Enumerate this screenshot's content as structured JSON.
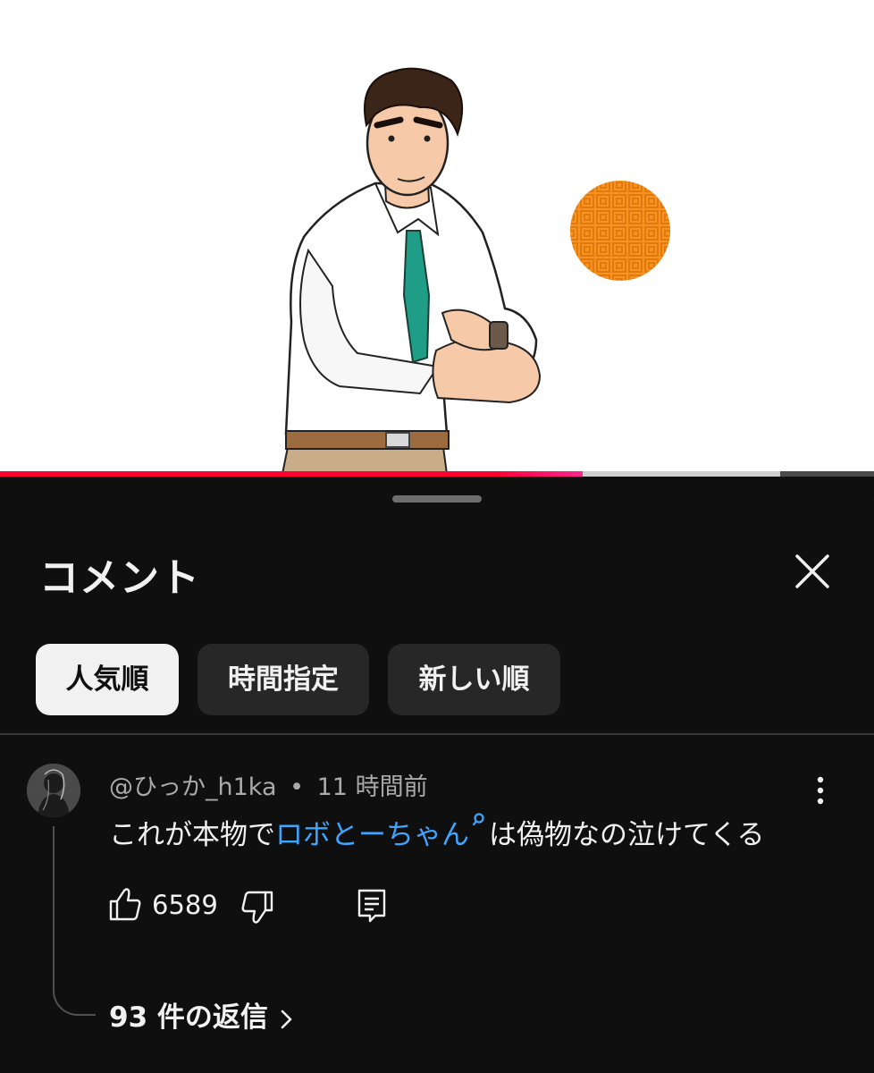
{
  "video": {
    "progress_played": 0.667,
    "progress_buffered": 0.893
  },
  "comments_panel": {
    "title": "コメント",
    "sort_chips": [
      {
        "label": "人気順",
        "active": true
      },
      {
        "label": "時間指定",
        "active": false
      },
      {
        "label": "新しい順",
        "active": false
      }
    ]
  },
  "comment": {
    "author": "@ひっか_h1ka",
    "separator": "•",
    "time": "11 時間前",
    "text_before": "これが本物で",
    "link_text": "ロボとーちゃん",
    "text_after": "は偽物なの泣けてくる",
    "like_count": "6589",
    "replies_label": "93 件の返信"
  },
  "colors": {
    "background": "#0f0f0f",
    "chip_active_bg": "#f1f1f1",
    "chip_bg": "#272727",
    "link": "#3ea6ff",
    "progress": "#ff0033"
  }
}
